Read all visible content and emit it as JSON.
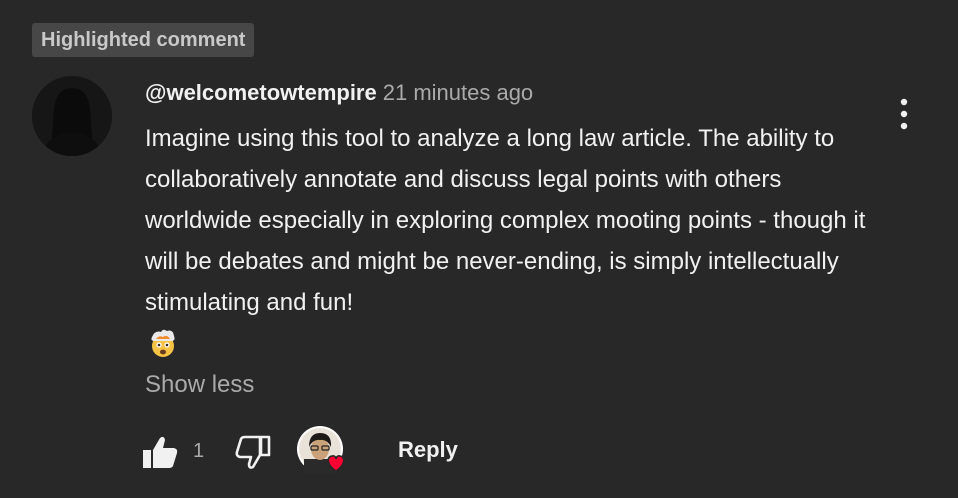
{
  "badge": {
    "label": "Highlighted comment"
  },
  "comment": {
    "author": "@welcometowtempire",
    "timestamp": "21 minutes ago",
    "text": "Imagine using this tool to analyze a long law article. The ability to collaboratively annotate and discuss legal points with others worldwide especially in exploring complex mooting points - though it will be debates and might be never-ending, is simply intellectually stimulating and fun!",
    "emoji": "exploding-head-emoji"
  },
  "actions": {
    "show_less": "Show less",
    "like_count": "1",
    "reply": "Reply"
  },
  "icons": {
    "menu": "more-vertical-icon",
    "like": "thumb-up-icon",
    "dislike": "thumb-down-icon",
    "creator_heart": "creator-heart-badge"
  },
  "colors": {
    "background": "#282828",
    "badge_bg": "#474747",
    "text_primary": "#f1f1f1",
    "text_secondary": "#aaaaaa",
    "heart": "#ff0033"
  }
}
